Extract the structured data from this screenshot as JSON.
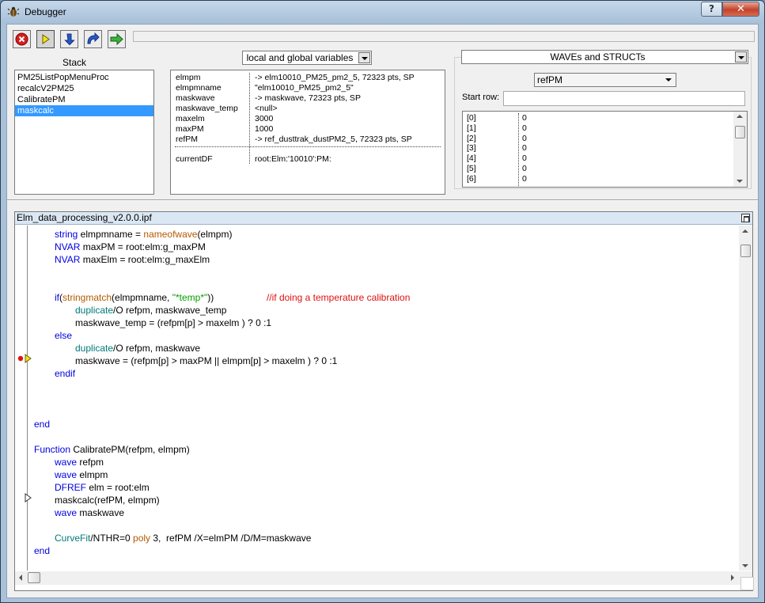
{
  "window": {
    "title": "Debugger",
    "help_label": "?",
    "close_label": "✕"
  },
  "toolbar": {
    "buttons": [
      {
        "name": "stop-button",
        "icon": "stop-icon"
      },
      {
        "name": "go-button",
        "icon": "go-arrow-icon"
      },
      {
        "name": "step-into-button",
        "icon": "step-into-icon"
      },
      {
        "name": "step-over-button",
        "icon": "step-over-icon"
      },
      {
        "name": "step-out-button",
        "icon": "step-out-icon"
      }
    ]
  },
  "stack": {
    "label": "Stack",
    "items": [
      "PM25ListPopMenuProc",
      "recalcV2PM25",
      "CalibratePM",
      "maskcalc"
    ],
    "selected_index": 3
  },
  "variables": {
    "scope_selector": "local and global variables",
    "rows": [
      {
        "name": "elmpm",
        "value": "-> elm10010_PM25_pm2_5, 72323 pts, SP"
      },
      {
        "name": "elmpmname",
        "value": "\"elm10010_PM25_pm2_5\""
      },
      {
        "name": "maskwave",
        "value": "-> maskwave, 72323 pts, SP"
      },
      {
        "name": "maskwave_temp",
        "value": "<null>"
      },
      {
        "name": "maxelm",
        "value": "3000"
      },
      {
        "name": "maxPM",
        "value": "1000"
      },
      {
        "name": "refPM",
        "value": "-> ref_dusttrak_dustPM2_5, 72323 pts, SP"
      }
    ],
    "current_df": {
      "name": "currentDF",
      "value": "root:Elm:'10010':PM:"
    }
  },
  "waves": {
    "type_selector": "WAVEs and STRUCTs",
    "wave_selector": "refPM",
    "start_row_label": "Start row:",
    "start_row_value": "",
    "rows": [
      {
        "index": "[0]",
        "value": "0"
      },
      {
        "index": "[1]",
        "value": "0"
      },
      {
        "index": "[2]",
        "value": "0"
      },
      {
        "index": "[3]",
        "value": "0"
      },
      {
        "index": "[4]",
        "value": "0"
      },
      {
        "index": "[5]",
        "value": "0"
      },
      {
        "index": "[6]",
        "value": "0"
      }
    ]
  },
  "code": {
    "file_title": "Elm_data_processing_v2.0.0.ipf",
    "breakpoint_line": 10,
    "current_line": 10,
    "caller_line": 22
  },
  "colors": {
    "keyword": "#0000e0",
    "function": "#007a7a",
    "builtin": "#b35a00",
    "string": "#00a000",
    "comment": "#e01010",
    "selection": "#3399ff"
  }
}
